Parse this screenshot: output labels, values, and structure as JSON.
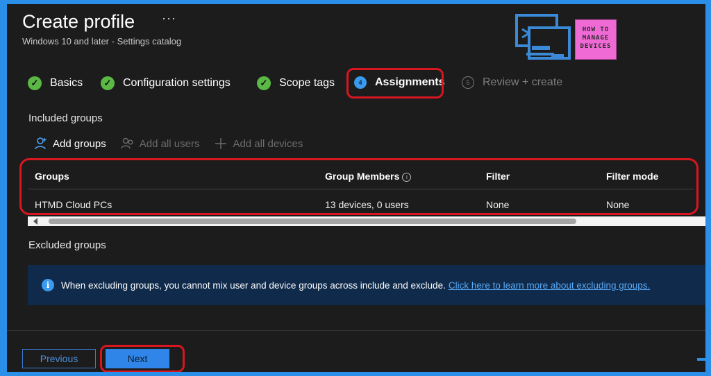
{
  "header": {
    "title": "Create profile",
    "more_label": "···",
    "subtitle": "Windows 10 and later - Settings catalog",
    "logo_text_1": "HOW TO",
    "logo_text_2": "MANAGE",
    "logo_text_3": "DEVICES"
  },
  "steps": [
    {
      "label": "Basics",
      "state": "done"
    },
    {
      "label": "Configuration settings",
      "state": "done"
    },
    {
      "label": "Scope tags",
      "state": "done"
    },
    {
      "label": "Assignments",
      "number": "4",
      "state": "current"
    },
    {
      "label": "Review + create",
      "number": "5",
      "state": "pending"
    }
  ],
  "included": {
    "heading": "Included groups",
    "actions": {
      "add_groups": "Add groups",
      "add_all_users": "Add all users",
      "add_all_devices": "Add all devices"
    },
    "columns": [
      "Groups",
      "Group Members",
      "Filter",
      "Filter mode"
    ],
    "rows": [
      {
        "group": "HTMD Cloud PCs",
        "members": "13 devices, 0 users",
        "filter": "None",
        "filter_mode": "None"
      }
    ]
  },
  "excluded": {
    "heading": "Excluded groups",
    "info_text": "When excluding groups, you cannot mix user and device groups across include and exclude.",
    "info_link": "Click here to learn more about excluding groups."
  },
  "footer": {
    "previous_label": "Previous",
    "next_label": "Next"
  },
  "colors": {
    "accent": "#2f86e8",
    "highlight": "#d8161f",
    "success": "#5ab944"
  }
}
